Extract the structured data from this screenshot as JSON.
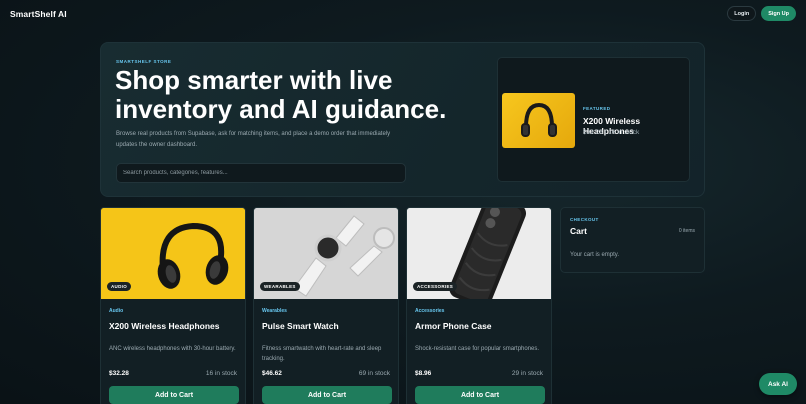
{
  "header": {
    "brand": "SmartShelf AI",
    "login_label": "Login",
    "signup_label": "Sign Up"
  },
  "hero": {
    "eyebrow": "SMARTSHELF STORE",
    "title": "Shop smarter with live inventory and AI guidance.",
    "subtitle": "Browse real products from Supabase, ask for matching items, and place a demo order that immediately updates the owner dashboard.",
    "search_placeholder": "Search products, categories, features...",
    "featured": {
      "label": "FEATURED",
      "name": "X200 Wireless Headphones",
      "meta": "$32.28 | 16 in stock",
      "image_icon": "headphones-image"
    }
  },
  "products": [
    {
      "badge": "AUDIO",
      "category": "Audio",
      "name": "X200 Wireless Headphones",
      "description": "ANC wireless headphones with 30-hour battery.",
      "price": "$32.28",
      "stock": "16 in stock",
      "button": "Add to Cart",
      "image_icon": "headphones-image",
      "image_bg": "#f5c518"
    },
    {
      "badge": "WEARABLES",
      "category": "Wearables",
      "name": "Pulse Smart Watch",
      "description": "Fitness smartwatch with heart-rate and sleep tracking.",
      "price": "$46.62",
      "stock": "69 in stock",
      "button": "Add to Cart",
      "image_icon": "smartwatch-image",
      "image_bg": "#d9d9d9"
    },
    {
      "badge": "ACCESSORIES",
      "category": "Accessories",
      "name": "Armor Phone Case",
      "description": "Shock-resistant case for popular smartphones.",
      "price": "$8.96",
      "stock": "29 in stock",
      "button": "Add to Cart",
      "image_icon": "phone-case-image",
      "image_bg": "#e8e8e8"
    }
  ],
  "cart": {
    "eyebrow": "CHECKOUT",
    "title": "Cart",
    "count": "0 items",
    "empty_text": "Your cart is empty."
  },
  "assistant": {
    "label": "Ask AI"
  },
  "colors": {
    "accent": "#1f8a66",
    "eyebrow": "#68c7ef",
    "background": "#0e1a1f"
  }
}
